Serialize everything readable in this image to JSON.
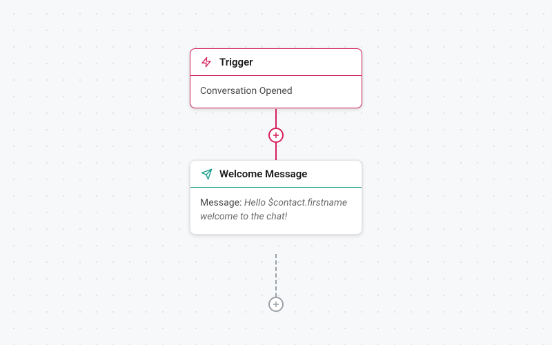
{
  "colors": {
    "trigger_accent": "#d41f59",
    "action_accent": "#1c9e8c",
    "dashed_connector": "#9aa0a6"
  },
  "nodes": {
    "trigger": {
      "icon": "lightning-icon",
      "title": "Trigger",
      "body": "Conversation Opened"
    },
    "action": {
      "icon": "send-icon",
      "title": "Welcome Message",
      "message_label": "Message:",
      "message_value": "Hello $contact.firstname welcome to the chat!"
    }
  },
  "buttons": {
    "add_between": "+",
    "add_end": "+"
  }
}
